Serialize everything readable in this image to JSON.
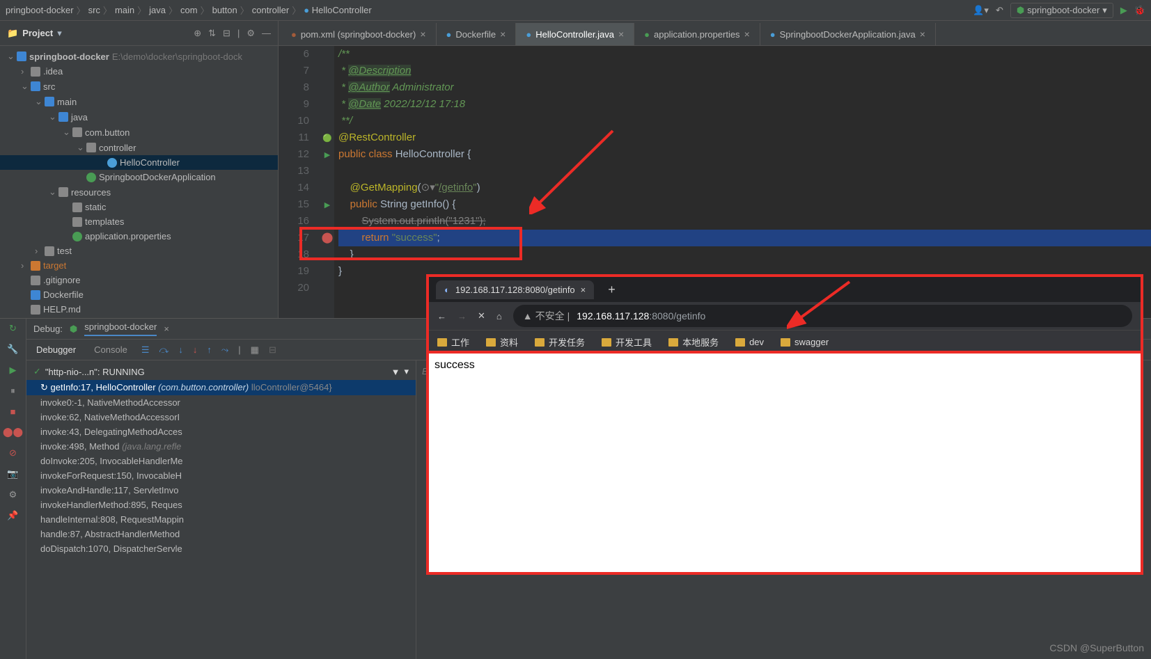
{
  "breadcrumb": [
    "pringboot-docker",
    "src",
    "main",
    "java",
    "com",
    "button",
    "controller",
    "HelloController"
  ],
  "runconfig": "springboot-docker",
  "project": {
    "title": "Project",
    "root": "springboot-docker",
    "rootpath": "E:\\demo\\docker\\springboot-dock",
    "tree": [
      {
        "d": 0,
        "arr": "v",
        "icon": "fold blue",
        "label": "springboot-docker",
        "suffix": "E:\\demo\\docker\\springboot-dock",
        "bold": true
      },
      {
        "d": 1,
        "arr": ">",
        "icon": "fold gray",
        "label": ".idea"
      },
      {
        "d": 1,
        "arr": "v",
        "icon": "fold blue",
        "label": "src"
      },
      {
        "d": 2,
        "arr": "v",
        "icon": "fold blue",
        "label": "main"
      },
      {
        "d": 3,
        "arr": "v",
        "icon": "fold blue",
        "label": "java"
      },
      {
        "d": 4,
        "arr": "v",
        "icon": "fold gray",
        "label": "com.button"
      },
      {
        "d": 5,
        "arr": "v",
        "icon": "fold gray",
        "label": "controller"
      },
      {
        "d": 6,
        "arr": "",
        "icon": "circ blue",
        "label": "HelloController",
        "sel": true
      },
      {
        "d": 5,
        "arr": "",
        "icon": "circ green",
        "label": "SpringbootDockerApplication"
      },
      {
        "d": 3,
        "arr": "v",
        "icon": "fold gray",
        "label": "resources"
      },
      {
        "d": 4,
        "arr": "",
        "icon": "fold gray",
        "label": "static"
      },
      {
        "d": 4,
        "arr": "",
        "icon": "fold gray",
        "label": "templates"
      },
      {
        "d": 4,
        "arr": "",
        "icon": "circ green",
        "label": "application.properties"
      },
      {
        "d": 2,
        "arr": ">",
        "icon": "fold gray",
        "label": "test"
      },
      {
        "d": 1,
        "arr": ">",
        "icon": "fold orange",
        "label": "target",
        "orange": true
      },
      {
        "d": 1,
        "arr": "",
        "icon": "fold gray",
        "label": ".gitignore"
      },
      {
        "d": 1,
        "arr": "",
        "icon": "fold blue",
        "label": "Dockerfile"
      },
      {
        "d": 1,
        "arr": "",
        "icon": "fold gray",
        "label": "HELP.md"
      }
    ]
  },
  "tabs": [
    {
      "icon": "m",
      "color": "#a35b3a",
      "label": "pom.xml (springboot-docker)",
      "close": true
    },
    {
      "icon": "d",
      "color": "#4a9ed8",
      "label": "Dockerfile",
      "close": true
    },
    {
      "icon": "c",
      "color": "#4a9ed8",
      "label": "HelloController.java",
      "close": true,
      "active": true
    },
    {
      "icon": "g",
      "color": "#499c54",
      "label": "application.properties",
      "close": true
    },
    {
      "icon": "c",
      "color": "#4a9ed8",
      "label": "SpringbootDockerApplication.java",
      "close": true
    }
  ],
  "code": {
    "start": 6,
    "lines": [
      {
        "n": 6,
        "html": "<span class='doc'>/**</span>"
      },
      {
        "n": 7,
        "html": "<span class='doc'> * </span><span class='doctag'>@Description</span>"
      },
      {
        "n": 8,
        "html": "<span class='doc'> * </span><span class='doctag'>@Author</span><span class='doc'> Administrator</span>"
      },
      {
        "n": 9,
        "html": "<span class='doc'> * </span><span class='doctag'>@Date</span><span class='doc'> 2022/12/12 17:18</span>"
      },
      {
        "n": 10,
        "html": "<span class='doc'> **/</span>"
      },
      {
        "n": 11,
        "html": "<span class='ann'>@RestController</span>",
        "gut": "🟢"
      },
      {
        "n": 12,
        "html": "<span class='kw'>public class </span>HelloController {",
        "gut": "▶"
      },
      {
        "n": 13,
        "html": ""
      },
      {
        "n": 14,
        "html": "    <span class='ann'>@GetMapping</span>(<span class='com'>⊙▾</span><span class='str'>\"</span><span class='str und'>/getinfo</span><span class='str'>\"</span>)"
      },
      {
        "n": 15,
        "html": "    <span class='kw'>public </span>String getInfo() {",
        "gut": "▶"
      },
      {
        "n": 16,
        "html": "        <span class='strike'>System.out.println(</span><span class='strike'>\"1231\"</span><span class='strike'>);</span>"
      },
      {
        "n": 17,
        "html": "        <span class='kw'>return </span><span class='str'>\"success\"</span>;",
        "sel": true,
        "bp": true
      },
      {
        "n": 18,
        "html": "    }"
      },
      {
        "n": 19,
        "html": "}"
      },
      {
        "n": 20,
        "html": ""
      }
    ]
  },
  "debug": {
    "title": "Debug:",
    "config": "springboot-docker",
    "tabs": [
      "Debugger",
      "Console"
    ],
    "thread": "\"http-nio-...n\": RUNNING",
    "evalprompt": "Evaluate expression (Enter) or add a w",
    "frames": [
      {
        "m": "getInfo:17, HelloController ",
        "p": "(com.button.controller)",
        "suf": "lloController@5464}",
        "sel": true
      },
      {
        "m": "invoke0:-1, NativeMethodAccessor",
        "p": ""
      },
      {
        "m": "invoke:62, NativeMethodAccessorI",
        "p": ""
      },
      {
        "m": "invoke:43, DelegatingMethodAcces",
        "p": ""
      },
      {
        "m": "invoke:498, Method ",
        "p": "(java.lang.refle"
      },
      {
        "m": "doInvoke:205, InvocableHandlerMe",
        "p": ""
      },
      {
        "m": "invokeForRequest:150, InvocableH",
        "p": ""
      },
      {
        "m": "invokeAndHandle:117, ServletInvo",
        "p": ""
      },
      {
        "m": "invokeHandlerMethod:895, Reques",
        "p": ""
      },
      {
        "m": "handleInternal:808, RequestMappin",
        "p": ""
      },
      {
        "m": "handle:87, AbstractHandlerMethod",
        "p": ""
      },
      {
        "m": "doDispatch:1070, DispatcherServle",
        "p": ""
      }
    ]
  },
  "browser": {
    "tabtitle": "192.168.117.128:8080/getinfo",
    "unsafe": "不安全",
    "host": "192.168.117.128",
    "port": ":8080",
    "path": "/getinfo",
    "bookmarks": [
      "工作",
      "资料",
      "开发任务",
      "开发工具",
      "本地服务",
      "dev",
      "swagger"
    ],
    "content": "success"
  },
  "watermark": "CSDN @SuperButton"
}
